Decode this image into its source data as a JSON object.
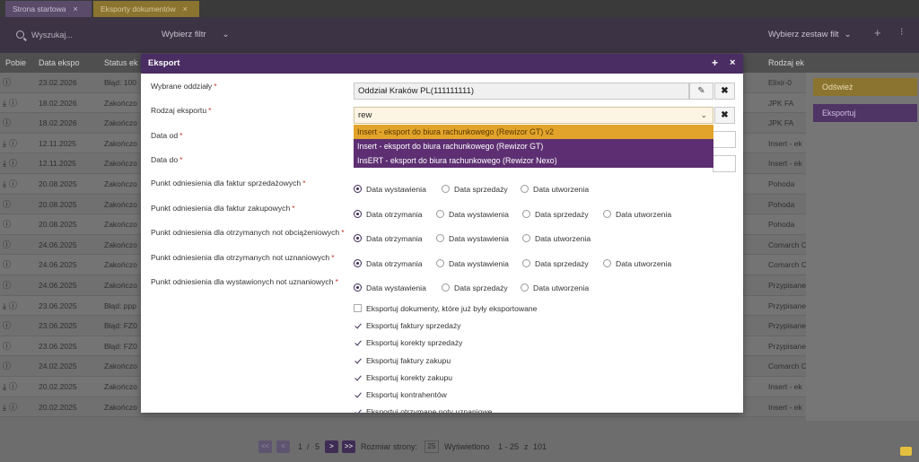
{
  "tabs": [
    {
      "label": "Strona startowa",
      "close": "×"
    },
    {
      "label": "Eksporty dokumentów",
      "close": "×"
    }
  ],
  "filterbar": {
    "search_placeholder": "Wyszukaj...",
    "filter_label": "Wybierz filtr",
    "filter_set_label": "Wybierz zestaw filt",
    "chevron": "⌄",
    "plus": "+",
    "more": "⁝"
  },
  "table": {
    "headers": [
      "Pobie",
      "Data ekspo",
      "Status ek",
      "Rodzaj ek"
    ],
    "rows": [
      {
        "icons": "i",
        "date": "23.02.2026",
        "status": "Błąd: 100",
        "kind": "Elixir-0"
      },
      {
        "icons": "d i",
        "date": "18.02.2026",
        "status": "Zakończo",
        "kind": "JPK FA"
      },
      {
        "icons": "i",
        "date": "18.02.2026",
        "status": "Zakończo",
        "kind": "JPK FA"
      },
      {
        "icons": "d i",
        "date": "12.11.2025",
        "status": "Zakończo",
        "kind": "Insert - ek"
      },
      {
        "icons": "d i",
        "date": "12.11.2025",
        "status": "Zakończo",
        "kind": "Insert - ek"
      },
      {
        "icons": "d i",
        "date": "20.08.2025",
        "status": "Zakończo",
        "kind": "Pohoda"
      },
      {
        "icons": "i",
        "date": "20.08.2025",
        "status": "Zakończo",
        "kind": "Pohoda"
      },
      {
        "icons": "i",
        "date": "20.08.2025",
        "status": "Zakończo",
        "kind": "Pohoda"
      },
      {
        "icons": "i",
        "date": "24.06.2025",
        "status": "Zakończo",
        "kind": "Comarch C"
      },
      {
        "icons": "i",
        "date": "24.06.2025",
        "status": "Zakończo",
        "kind": "Comarch C"
      },
      {
        "icons": "i",
        "date": "24.06.2025",
        "status": "Zakończo",
        "kind": "Przypisane"
      },
      {
        "icons": "d i",
        "date": "23.06.2025",
        "status": "Błąd: ppp",
        "kind": "Przypisane"
      },
      {
        "icons": "i",
        "date": "23.06.2025",
        "status": "Błąd: FZ0",
        "kind": "Przypisane"
      },
      {
        "icons": "i",
        "date": "23.06.2025",
        "status": "Błąd: FZ0",
        "kind": "Przypisane"
      },
      {
        "icons": "i",
        "date": "24.02.2025",
        "status": "Zakończo",
        "kind": "Comarch C"
      },
      {
        "icons": "d i",
        "date": "20.02.2025",
        "status": "Zakończo",
        "kind": "Insert - ek"
      },
      {
        "icons": "d i",
        "date": "20.02.2025",
        "status": "Zakończo",
        "kind": "Insert - ek"
      }
    ]
  },
  "side": {
    "refresh_label": "Odśwież",
    "export_label": "Eksportuj"
  },
  "pager": {
    "first": "<<",
    "prev": "<",
    "page": "1",
    "sep": "/",
    "total_pages": "5",
    "next": ">",
    "last": ">>",
    "size_label": "Rozmiar strony:",
    "size": "25",
    "shown_label": "Wyświetlono",
    "range": "1 - 25",
    "of": "z",
    "total": "101"
  },
  "modal": {
    "title": "Eksport",
    "plus": "+",
    "close": "×",
    "fields": {
      "branches": {
        "label": "Wybrane oddziały",
        "value": "Oddział Kraków PL(111111111)"
      },
      "export_kind": {
        "label": "Rodzaj eksportu",
        "value": "rew"
      },
      "date_from": {
        "label": "Data od"
      },
      "date_to": {
        "label": "Data do"
      }
    },
    "required": "*",
    "edit_icon": "✎",
    "clear_icon": "✖",
    "dropdown_arrow": "⌄",
    "options": [
      "Insert - eksport do biura rachunkowego (Rewizor GT) v2",
      "Insert - eksport do biura rachunkowego (Rewizor GT)",
      "InsERT - eksport do biura rachunkowego (Rewizor Nexo)"
    ],
    "radio_groups": [
      {
        "label": "Punkt odniesienia dla faktur sprzedażowych",
        "options": [
          "Data wystawienia",
          "Data sprzedaży",
          "Data utworzenia"
        ],
        "selected": 0
      },
      {
        "label": "Punkt odniesienia dla faktur zakupowych",
        "options": [
          "Data otrzymania",
          "Data wystawienia",
          "Data sprzedaży",
          "Data utworzenia"
        ],
        "selected": 0
      },
      {
        "label": "Punkt odniesienia dla otrzymanych not obciążeniowych",
        "options": [
          "Data otrzymania",
          "Data wystawienia",
          "Data utworzenia"
        ],
        "selected": 0
      },
      {
        "label": "Punkt odniesienia dla otrzymanych not uznaniowych",
        "options": [
          "Data otrzymania",
          "Data wystawienia",
          "Data sprzedaży",
          "Data utworzenia"
        ],
        "selected": 0
      },
      {
        "label": "Punkt odniesienia dla wystawionych not uznaniowych",
        "options": [
          "Data wystawienia",
          "Data sprzedaży",
          "Data utworzenia"
        ],
        "selected": 0
      }
    ],
    "checkboxes": [
      {
        "label": "Eksportuj dokumenty, które już były eksportowane",
        "checked": false
      },
      {
        "label": "Eksportuj faktury sprzedaży",
        "checked": true
      },
      {
        "label": "Eksportuj korekty sprzedaży",
        "checked": true
      },
      {
        "label": "Eksportuj faktury zakupu",
        "checked": true
      },
      {
        "label": "Eksportuj korekty zakupu",
        "checked": true
      },
      {
        "label": "Eksportuj kontrahentów",
        "checked": true
      },
      {
        "label": "Eksportuj otrzymane noty uznaniowe",
        "checked": true
      }
    ]
  }
}
